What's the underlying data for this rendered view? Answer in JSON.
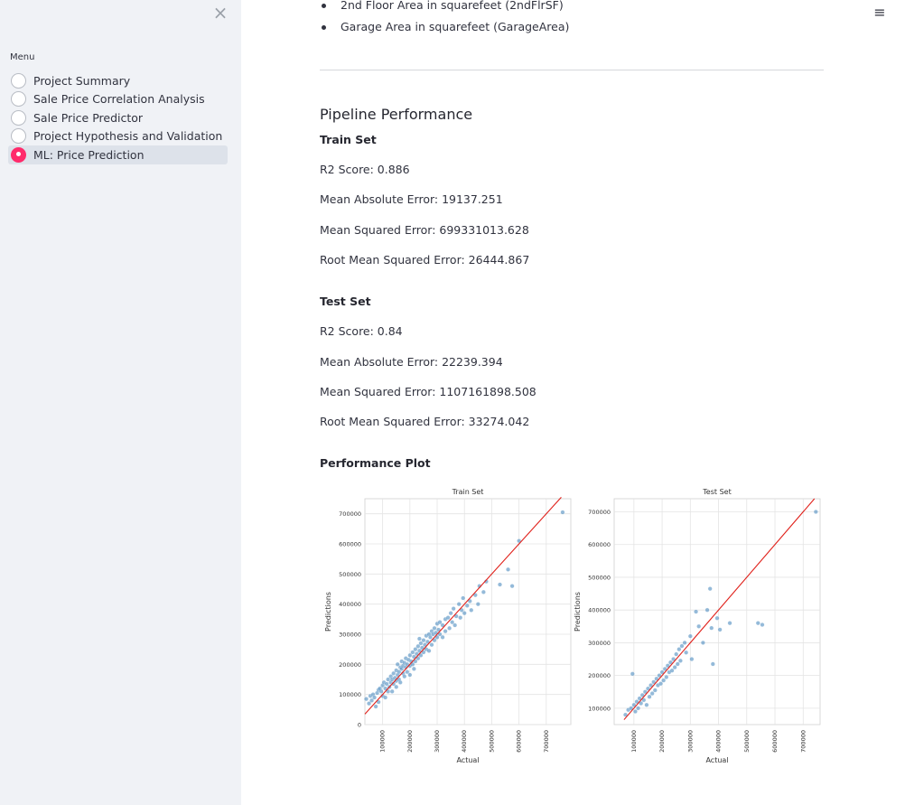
{
  "sidebar": {
    "close_icon": "×",
    "menu_label": "Menu",
    "items": [
      {
        "label": "Project Summary",
        "selected": false
      },
      {
        "label": "Sale Price Correlation Analysis",
        "selected": false
      },
      {
        "label": "Sale Price Predictor",
        "selected": false
      },
      {
        "label": "Project Hypothesis and Validation",
        "selected": false
      },
      {
        "label": "ML: Price Prediction",
        "selected": true
      }
    ],
    "accent_color": "#ff2b6b"
  },
  "header": {
    "menu_icon": "≡"
  },
  "main": {
    "bullets": [
      "2nd Floor Area in squarefeet (2ndFlrSF)",
      "Garage Area in squarefeet (GarageArea)"
    ],
    "section_title": "Pipeline Performance",
    "train": {
      "heading": "Train Set",
      "r2": "R2 Score: 0.886",
      "mae": "Mean Absolute Error: 19137.251",
      "mse": "Mean Squared Error: 699331013.628",
      "rmse": "Root Mean Squared Error: 26444.867"
    },
    "test": {
      "heading": "Test Set",
      "r2": "R2 Score: 0.84",
      "mae": "Mean Absolute Error: 22239.394",
      "mse": "Mean Squared Error: 1107161898.508",
      "rmse": "Root Mean Squared Error: 33274.042"
    },
    "plot_heading": "Performance Plot"
  },
  "chart_data": [
    {
      "type": "scatter",
      "title": "Train Set",
      "xlabel": "Actual",
      "ylabel": "Predictions",
      "xlim": [
        35000,
        790000
      ],
      "ylim": [
        0,
        750000
      ],
      "xticks": [
        0,
        100000,
        200000,
        300000,
        400000,
        500000,
        600000,
        700000
      ],
      "yticks": [
        0,
        100000,
        200000,
        300000,
        400000,
        500000,
        600000,
        700000
      ],
      "grid": true,
      "point_color": "#4c8cc0",
      "line_color": "#e0201a",
      "reference_line": [
        [
          35000,
          35000
        ],
        [
          755000,
          755000
        ]
      ],
      "points": [
        [
          40000,
          85000
        ],
        [
          50000,
          70000
        ],
        [
          55000,
          95000
        ],
        [
          60000,
          80000
        ],
        [
          65000,
          100000
        ],
        [
          70000,
          90000
        ],
        [
          75000,
          60000
        ],
        [
          80000,
          105000
        ],
        [
          85000,
          115000
        ],
        [
          85000,
          75000
        ],
        [
          90000,
          120000
        ],
        [
          95000,
          110000
        ],
        [
          100000,
          95000
        ],
        [
          100000,
          130000
        ],
        [
          105000,
          140000
        ],
        [
          110000,
          120000
        ],
        [
          110000,
          90000
        ],
        [
          115000,
          135000
        ],
        [
          120000,
          150000
        ],
        [
          120000,
          110000
        ],
        [
          125000,
          125000
        ],
        [
          130000,
          160000
        ],
        [
          130000,
          140000
        ],
        [
          135000,
          150000
        ],
        [
          135000,
          110000
        ],
        [
          140000,
          170000
        ],
        [
          140000,
          135000
        ],
        [
          145000,
          155000
        ],
        [
          150000,
          180000
        ],
        [
          150000,
          145000
        ],
        [
          150000,
          125000
        ],
        [
          155000,
          165000
        ],
        [
          155000,
          200000
        ],
        [
          160000,
          175000
        ],
        [
          160000,
          150000
        ],
        [
          165000,
          190000
        ],
        [
          165000,
          140000
        ],
        [
          170000,
          185000
        ],
        [
          170000,
          210000
        ],
        [
          175000,
          170000
        ],
        [
          175000,
          195000
        ],
        [
          180000,
          205000
        ],
        [
          180000,
          160000
        ],
        [
          185000,
          220000
        ],
        [
          185000,
          190000
        ],
        [
          190000,
          200000
        ],
        [
          190000,
          175000
        ],
        [
          195000,
          215000
        ],
        [
          200000,
          230000
        ],
        [
          200000,
          195000
        ],
        [
          200000,
          165000
        ],
        [
          205000,
          210000
        ],
        [
          210000,
          240000
        ],
        [
          210000,
          200000
        ],
        [
          215000,
          225000
        ],
        [
          215000,
          185000
        ],
        [
          220000,
          250000
        ],
        [
          220000,
          210000
        ],
        [
          225000,
          235000
        ],
        [
          230000,
          260000
        ],
        [
          230000,
          220000
        ],
        [
          235000,
          245000
        ],
        [
          235000,
          285000
        ],
        [
          240000,
          270000
        ],
        [
          240000,
          230000
        ],
        [
          245000,
          255000
        ],
        [
          250000,
          280000
        ],
        [
          250000,
          240000
        ],
        [
          255000,
          265000
        ],
        [
          260000,
          295000
        ],
        [
          260000,
          250000
        ],
        [
          265000,
          275000
        ],
        [
          270000,
          300000
        ],
        [
          270000,
          245000
        ],
        [
          275000,
          290000
        ],
        [
          280000,
          310000
        ],
        [
          280000,
          265000
        ],
        [
          285000,
          300000
        ],
        [
          290000,
          320000
        ],
        [
          290000,
          280000
        ],
        [
          295000,
          305000
        ],
        [
          300000,
          335000
        ],
        [
          300000,
          290000
        ],
        [
          305000,
          315000
        ],
        [
          310000,
          340000
        ],
        [
          310000,
          300000
        ],
        [
          320000,
          330000
        ],
        [
          320000,
          290000
        ],
        [
          330000,
          350000
        ],
        [
          330000,
          310000
        ],
        [
          340000,
          355000
        ],
        [
          345000,
          320000
        ],
        [
          350000,
          370000
        ],
        [
          355000,
          340000
        ],
        [
          360000,
          385000
        ],
        [
          365000,
          330000
        ],
        [
          370000,
          360000
        ],
        [
          380000,
          400000
        ],
        [
          385000,
          355000
        ],
        [
          390000,
          380000
        ],
        [
          395000,
          420000
        ],
        [
          400000,
          370000
        ],
        [
          410000,
          395000
        ],
        [
          420000,
          410000
        ],
        [
          425000,
          380000
        ],
        [
          440000,
          430000
        ],
        [
          450000,
          400000
        ],
        [
          455000,
          460000
        ],
        [
          470000,
          440000
        ],
        [
          480000,
          475000
        ],
        [
          530000,
          465000
        ],
        [
          560000,
          515000
        ],
        [
          575000,
          460000
        ],
        [
          600000,
          610000
        ],
        [
          760000,
          705000
        ]
      ]
    },
    {
      "type": "scatter",
      "title": "Test Set",
      "xlabel": "Actual",
      "ylabel": "Predictions",
      "xlim": [
        30000,
        760000
      ],
      "ylim": [
        50000,
        740000
      ],
      "xticks": [
        100000,
        200000,
        300000,
        400000,
        500000,
        600000,
        700000
      ],
      "yticks": [
        100000,
        200000,
        300000,
        400000,
        500000,
        600000,
        700000
      ],
      "grid": true,
      "point_color": "#4c8cc0",
      "line_color": "#e0201a",
      "reference_line": [
        [
          65000,
          65000
        ],
        [
          740000,
          740000
        ]
      ],
      "points": [
        [
          70000,
          80000
        ],
        [
          80000,
          95000
        ],
        [
          90000,
          100000
        ],
        [
          95000,
          205000
        ],
        [
          100000,
          110000
        ],
        [
          105000,
          90000
        ],
        [
          110000,
          120000
        ],
        [
          115000,
          100000
        ],
        [
          120000,
          130000
        ],
        [
          125000,
          115000
        ],
        [
          130000,
          140000
        ],
        [
          135000,
          125000
        ],
        [
          140000,
          150000
        ],
        [
          145000,
          110000
        ],
        [
          150000,
          160000
        ],
        [
          155000,
          135000
        ],
        [
          160000,
          170000
        ],
        [
          165000,
          145000
        ],
        [
          170000,
          180000
        ],
        [
          175000,
          155000
        ],
        [
          180000,
          190000
        ],
        [
          185000,
          170000
        ],
        [
          190000,
          200000
        ],
        [
          195000,
          175000
        ],
        [
          200000,
          210000
        ],
        [
          205000,
          185000
        ],
        [
          210000,
          220000
        ],
        [
          215000,
          195000
        ],
        [
          220000,
          230000
        ],
        [
          225000,
          210000
        ],
        [
          230000,
          240000
        ],
        [
          235000,
          215000
        ],
        [
          240000,
          250000
        ],
        [
          245000,
          225000
        ],
        [
          250000,
          265000
        ],
        [
          255000,
          235000
        ],
        [
          260000,
          280000
        ],
        [
          265000,
          245000
        ],
        [
          270000,
          290000
        ],
        [
          280000,
          300000
        ],
        [
          285000,
          270000
        ],
        [
          300000,
          320000
        ],
        [
          305000,
          250000
        ],
        [
          320000,
          395000
        ],
        [
          330000,
          350000
        ],
        [
          345000,
          300000
        ],
        [
          360000,
          400000
        ],
        [
          370000,
          465000
        ],
        [
          375000,
          345000
        ],
        [
          380000,
          235000
        ],
        [
          395000,
          375000
        ],
        [
          405000,
          340000
        ],
        [
          440000,
          360000
        ],
        [
          540000,
          360000
        ],
        [
          555000,
          355000
        ],
        [
          745000,
          700000
        ]
      ]
    }
  ]
}
